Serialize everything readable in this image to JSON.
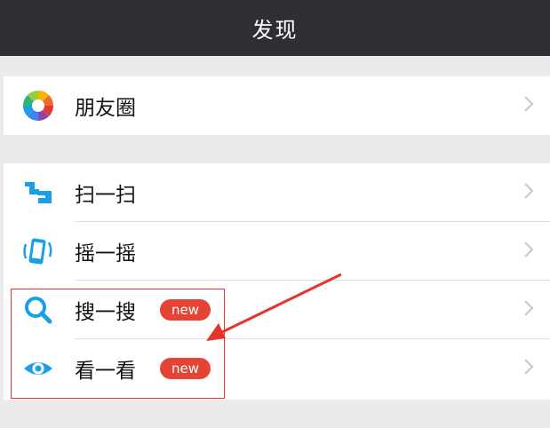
{
  "header": {
    "title": "发现"
  },
  "groups": [
    {
      "items": [
        {
          "label": "朋友圈",
          "icon": "moments-aperture-icon"
        }
      ]
    },
    {
      "items": [
        {
          "label": "扫一扫",
          "icon": "scan-icon"
        },
        {
          "label": "摇一摇",
          "icon": "shake-phone-icon"
        },
        {
          "label": "搜一搜",
          "icon": "search-icon",
          "badge": "new"
        },
        {
          "label": "看一看",
          "icon": "eye-icon",
          "badge": "new"
        }
      ]
    }
  ],
  "colors": {
    "header_bg": "#2e2e33",
    "badge_bg": "#e54335",
    "annotation": "#e8332a",
    "accent_blue": "#1aa0e6"
  }
}
